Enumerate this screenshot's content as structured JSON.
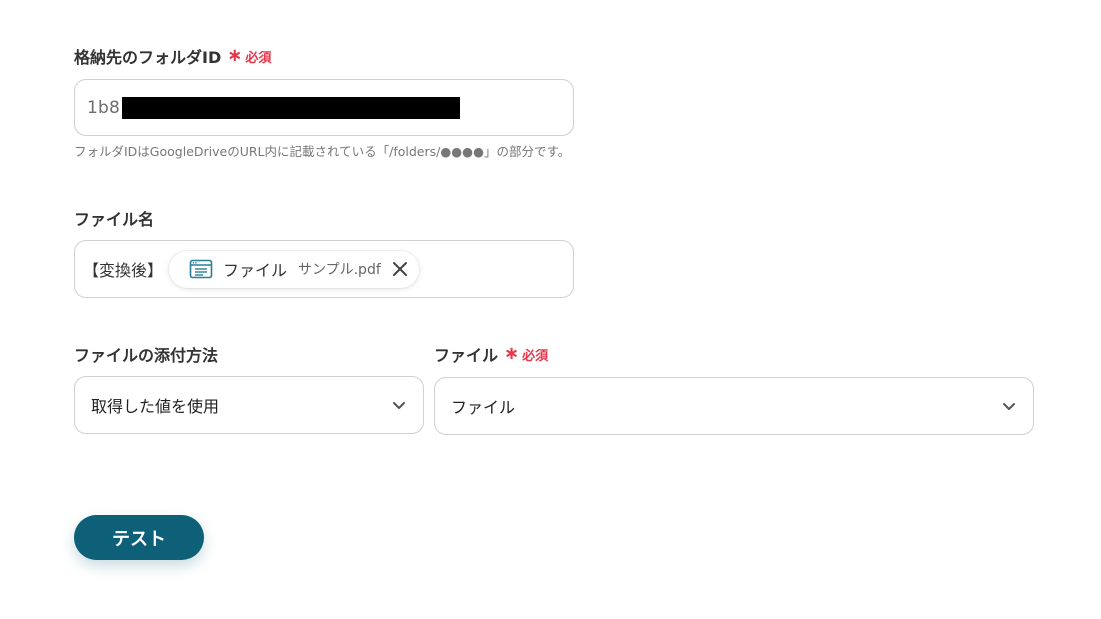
{
  "folder": {
    "label": "格納先のフォルダID",
    "required_mark": "∗",
    "required_text": "必須",
    "value_visible": "1b8",
    "help_text": "フォルダIDはGoogleDriveのURL内に記載されている「/folders/●●●●」の部分です。"
  },
  "filename": {
    "label": "ファイル名",
    "prefix": "【変換後】",
    "chip": {
      "icon": "window-icon",
      "name": "ファイル",
      "sub": "サンプル.pdf",
      "close_icon": "close-icon"
    }
  },
  "attach_method": {
    "label": "ファイルの添付方法",
    "value": "取得した値を使用",
    "icon": "chevron-down-icon"
  },
  "file": {
    "label": "ファイル",
    "required_mark": "∗",
    "required_text": "必須",
    "value": "ファイル",
    "icon": "chevron-down-icon"
  },
  "actions": {
    "test_label": "テスト"
  },
  "colors": {
    "accent": "#0d6078",
    "required": "#e5374a",
    "chip_icon": "#2a7f97",
    "border": "#cfcfd4"
  }
}
